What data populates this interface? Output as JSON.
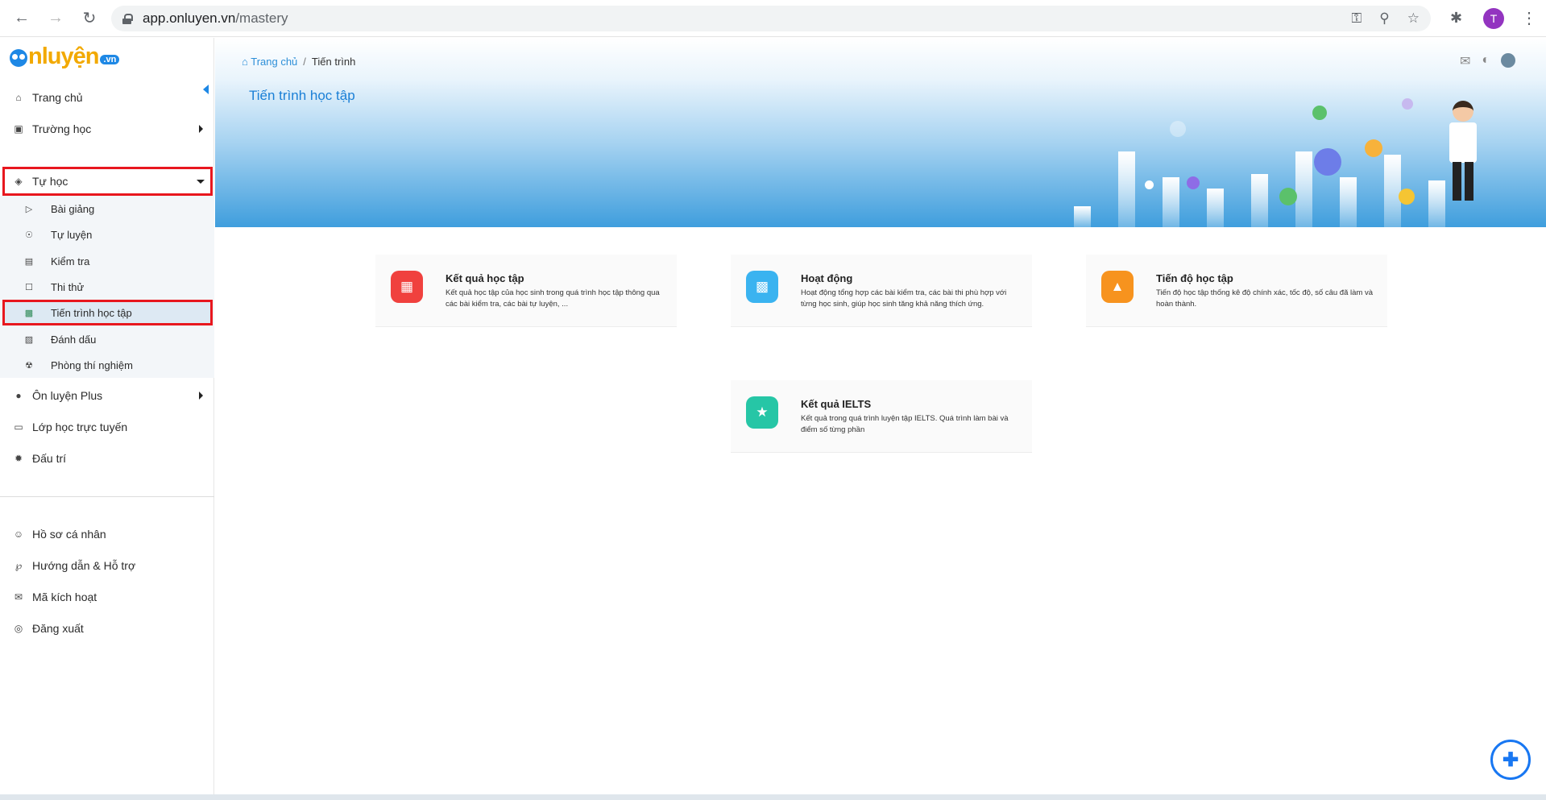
{
  "browser": {
    "url_host": "app.onluyen.vn",
    "url_path": "/mastery",
    "profile_initial": "T"
  },
  "logo": {
    "main": "nluyện",
    "suffix": ".vn"
  },
  "sidebar": {
    "items": [
      {
        "label": "Trang chủ",
        "icon": "home-icon"
      },
      {
        "label": "Trường học",
        "icon": "school-icon"
      },
      {
        "label": "Tự học",
        "icon": "graduation-cap-icon"
      }
    ],
    "sub_items": [
      {
        "label": "Bài giảng",
        "icon": "video-icon"
      },
      {
        "label": "Tự luyện",
        "icon": "practice-icon"
      },
      {
        "label": "Kiểm tra",
        "icon": "test-icon"
      },
      {
        "label": "Thi thử",
        "icon": "exam-icon"
      },
      {
        "label": "Tiến trình học tập",
        "icon": "chart-icon"
      },
      {
        "label": "Đánh dấu",
        "icon": "bookmark-icon"
      },
      {
        "label": "Phòng thí nghiệm",
        "icon": "lab-icon"
      }
    ],
    "items2": [
      {
        "label": "Ôn luyện Plus",
        "icon": "bomb-icon"
      },
      {
        "label": "Lớp học trực tuyến",
        "icon": "monitor-icon"
      },
      {
        "label": "Đấu trí",
        "icon": "battle-icon"
      }
    ],
    "bottom_items": [
      {
        "label": "Hồ sơ cá nhân",
        "icon": "user-icon"
      },
      {
        "label": "Hướng dẫn & Hỗ trợ",
        "icon": "help-icon"
      },
      {
        "label": "Mã kích hoạt",
        "icon": "mail-icon"
      },
      {
        "label": "Đăng xuất",
        "icon": "power-icon"
      }
    ]
  },
  "breadcrumb": {
    "home": "Trang chủ",
    "separator": "/",
    "current": "Tiến trình"
  },
  "page_title": "Tiến trình học tập",
  "cards": [
    {
      "title": "Kết quả học tập",
      "desc": "Kết quả học tập của học sinh trong quá trình học tập thông qua các bài kiểm tra, các bài tự luyện, ...",
      "color": "#f0413e",
      "icon": "presentation-icon"
    },
    {
      "title": "Hoạt động",
      "desc": "Hoạt động tổng hợp các bài kiểm tra, các bài thi phù hợp với từng học sinh, giúp học sinh tăng khả năng thích ứng.",
      "color": "#3ab3f0",
      "icon": "bar-chart-icon"
    },
    {
      "title": "Tiến độ học tập",
      "desc": "Tiến độ học tập thống kê độ chính xác, tốc độ, số câu đã làm và hoàn thành.",
      "color": "#f7931e",
      "icon": "growth-chart-icon"
    },
    {
      "title": "Kết quả IELTS",
      "desc": "Kết quả trong quá trình luyện tập IELTS. Quá trình làm bài và điểm số từng phần",
      "color": "#26c6a6",
      "icon": "trophy-icon"
    }
  ]
}
